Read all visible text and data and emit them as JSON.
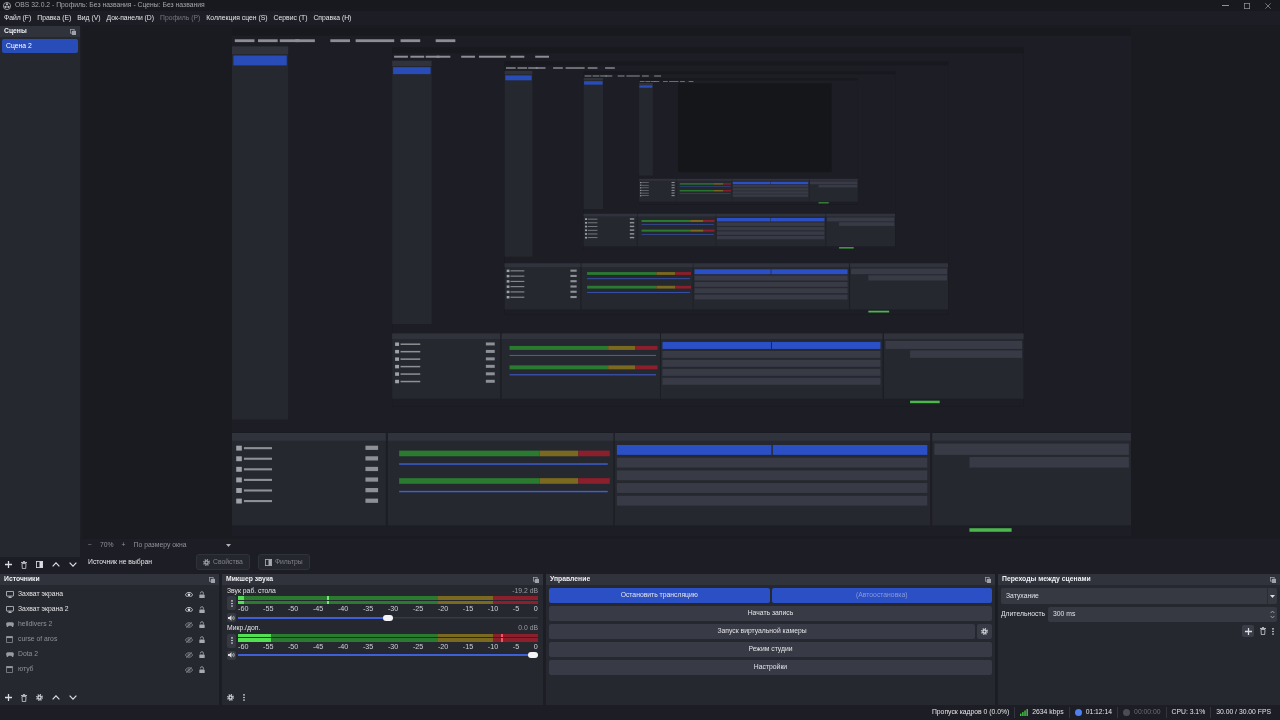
{
  "window": {
    "title": "OBS 32.0.2 - Профиль: Без названия - Сцены: Без названия"
  },
  "menu": [
    {
      "label": "Файл (F)",
      "disabled": false
    },
    {
      "label": "Правка (E)",
      "disabled": false
    },
    {
      "label": "Вид (V)",
      "disabled": false
    },
    {
      "label": "Док-панели (D)",
      "disabled": false
    },
    {
      "label": "Профиль (P)",
      "disabled": true
    },
    {
      "label": "Коллекция сцен (S)",
      "disabled": false
    },
    {
      "label": "Сервис (T)",
      "disabled": false
    },
    {
      "label": "Справка (H)",
      "disabled": false
    }
  ],
  "scenes": {
    "title": "Сцены",
    "items": [
      {
        "label": "Сцена 2",
        "selected": true
      }
    ]
  },
  "preview": {
    "zoom_out": "−",
    "zoom": "70%",
    "zoom_in": "+",
    "scale_mode": "По размеру окна"
  },
  "context_bar": {
    "status": "Источник не выбран",
    "buttons": [
      {
        "label": "Свойства",
        "kind": "properties",
        "disabled": true
      },
      {
        "label": "Фильтры",
        "kind": "filters",
        "disabled": true
      }
    ]
  },
  "sources": {
    "title": "Источники",
    "items": [
      {
        "label": "Захват экрана",
        "kind": "display",
        "visible": true
      },
      {
        "label": "Захват экрана 2",
        "kind": "display",
        "visible": true
      },
      {
        "label": "helldivers 2",
        "kind": "game",
        "visible": false
      },
      {
        "label": "curse of aros",
        "kind": "window",
        "visible": false
      },
      {
        "label": "Dota 2",
        "kind": "game",
        "visible": false
      },
      {
        "label": "ютуб",
        "kind": "window",
        "visible": false
      }
    ]
  },
  "mixer": {
    "title": "Микшер звука",
    "channels": [
      {
        "name": "Звук раб. стола",
        "reading": "-19.2 dB",
        "muted": false,
        "meter": {
          "level": 0.02,
          "peak": {
            "level": 0.3
          }
        },
        "scale": [
          "-60",
          "-55",
          "-50",
          "-45",
          "-40",
          "-35",
          "-30",
          "-25",
          "-20",
          "-15",
          "-10",
          "-5",
          "0"
        ],
        "volume": {
          "level": 0.5
        }
      },
      {
        "name": "Микр./доп.",
        "reading": "0.0 dB",
        "muted": false,
        "meter": {
          "level": 0.11,
          "peak": {
            "level": 0.88
          }
        },
        "scale": [
          "-60",
          "-55",
          "-50",
          "-45",
          "-40",
          "-35",
          "-30",
          "-25",
          "-20",
          "-15",
          "-10",
          "-5",
          "0"
        ],
        "volume": {
          "level": 1
        }
      }
    ]
  },
  "controls": {
    "title": "Управление",
    "rows": [
      {
        "buttons": [
          {
            "kind": "text",
            "label": "Остановить трансляцию",
            "checked": true,
            "disabled": false
          },
          {
            "kind": "text",
            "label": "(Автоостановка)",
            "checked": true,
            "disabled": true
          }
        ]
      },
      {
        "buttons": [
          {
            "kind": "text",
            "label": "Начать запись",
            "checked": false,
            "disabled": false
          }
        ]
      },
      {
        "buttons": [
          {
            "kind": "text",
            "label": "Запуск виртуальной камеры",
            "checked": false,
            "disabled": false
          },
          {
            "kind": "settings"
          }
        ]
      },
      {
        "buttons": [
          {
            "kind": "text",
            "label": "Режим студии",
            "checked": false,
            "disabled": false
          }
        ]
      },
      {
        "buttons": [
          {
            "kind": "text",
            "label": "Настройки",
            "checked": false,
            "disabled": false
          }
        ]
      }
    ]
  },
  "transitions": {
    "title": "Переходы между сценами",
    "transition": "Затухание",
    "duration_label": "Длительность",
    "duration": "300 ms"
  },
  "status_bar": [
    {
      "kind": "dropped_frames",
      "text": "Пропуск кадров 0 (0.0%)"
    },
    {
      "kind": "bitrate",
      "text": "2634 kbps"
    },
    {
      "kind": "stream_time",
      "text": "01:12:14",
      "active": true
    },
    {
      "kind": "record_time",
      "text": "00:00:00",
      "active": false
    },
    {
      "kind": "cpu",
      "text": "CPU: 3.1%"
    },
    {
      "kind": "fps",
      "text": "30.00 / 30.00 FPS"
    }
  ]
}
